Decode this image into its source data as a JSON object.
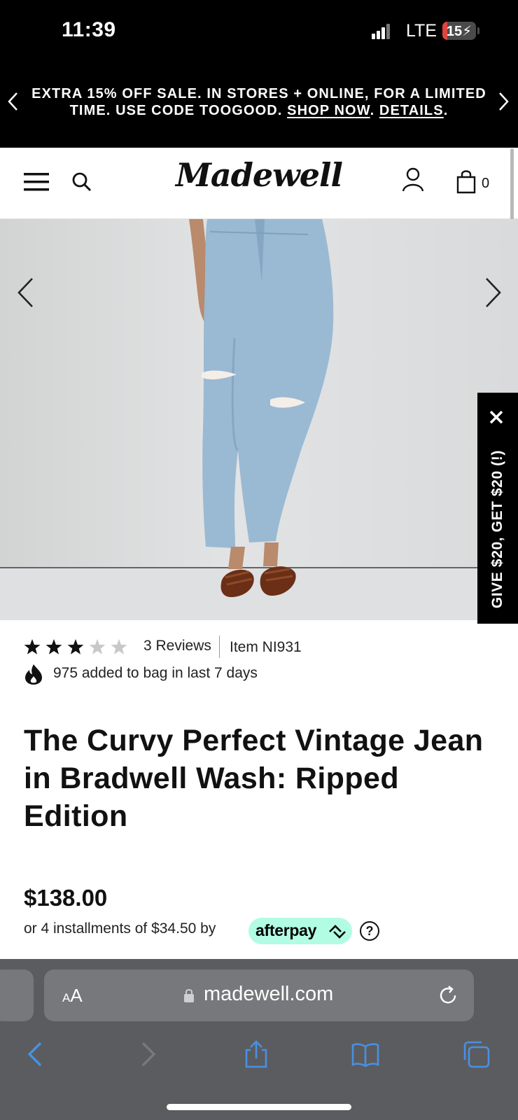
{
  "status_bar": {
    "time": "11:39",
    "network": "LTE",
    "battery": "15",
    "battery_level_percent": 15
  },
  "promo": {
    "text": "EXTRA 15% OFF SALE. IN STORES + ONLINE, FOR A LIMITED TIME. USE CODE TOOGOOD.",
    "shop_now": "SHOP NOW",
    "details": "DETAILS"
  },
  "header": {
    "logo": "Madewell",
    "bag_count": "0"
  },
  "referral": {
    "label": "GIVE $20, GET $20 (!)"
  },
  "product": {
    "rating": 3,
    "rating_max": 5,
    "reviews": "3 Reviews",
    "item_number": "Item NI931",
    "popularity": "975 added to bag in last 7 days",
    "title": "The Curvy Perfect Vintage Jean in Bradwell Wash: Ripped Edition",
    "price": "$138.00",
    "installments": "or 4 installments of $34.50 by",
    "afterpay": "afterpay"
  },
  "browser": {
    "aa_label_small": "A",
    "aa_label_big": "A",
    "domain": "madewell.com"
  },
  "icons": {
    "promo_prev": "chevron-left-icon",
    "promo_next": "chevron-right-icon",
    "menu": "hamburger-menu-icon",
    "search": "search-icon",
    "account": "user-icon",
    "bag": "shopping-bag-icon",
    "flame": "flame-icon",
    "help": "question-circle-icon",
    "close": "close-icon",
    "lock": "lock-icon",
    "reload": "reload-icon",
    "back": "back-arrow-icon",
    "forward": "forward-arrow-icon",
    "share": "share-icon",
    "bookmarks": "bookmarks-icon",
    "tabs": "tabs-icon"
  },
  "colors": {
    "banner": "#000000",
    "afterpay": "#B2FCE4",
    "safari_accent": "#4A90E2",
    "safari_bar": "#5B5C5F",
    "battery_low": "#E0443E"
  }
}
